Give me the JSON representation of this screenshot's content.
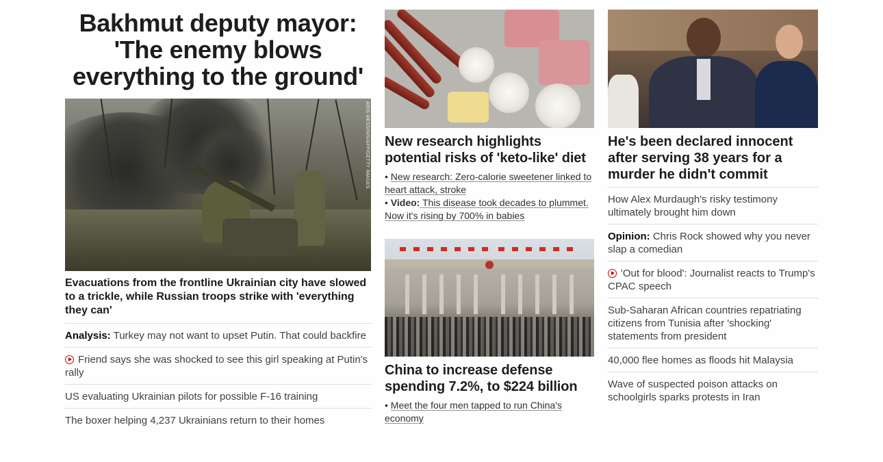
{
  "col1": {
    "headline": "Bakhmut deputy mayor: 'The enemy blows everything to the ground'",
    "image_credit": "ARIS MESSINIS/AFP/GETTY IMAGES",
    "caption": "Evacuations from the frontline Ukrainian city have slowed to a trickle, while Russian troops strike with 'everything they can'",
    "links": [
      {
        "label": "Analysis:",
        "text": " Turkey may not want to upset Putin. That could backfire"
      },
      {
        "text": "Friend says she was shocked to see this girl speaking at Putin's rally",
        "video": true
      },
      {
        "text": "US evaluating Ukrainian pilots for possible F-16 training"
      },
      {
        "text": "The boxer helping 4,237 Ukrainians return to their homes"
      }
    ]
  },
  "col2": {
    "story1": {
      "headline": "New research highlights potential risks of 'keto-like' diet",
      "bullets": [
        {
          "text": "New research: Zero-calorie sweetener linked to heart attack, stroke"
        },
        {
          "label": "Video:",
          "text": " This disease took decades to plummet. Now it's rising by 700% in babies"
        }
      ]
    },
    "story2": {
      "headline": "China to increase defense spending 7.2%, to $224 billion",
      "bullets": [
        {
          "text": "Meet the four men tapped to run China's economy"
        }
      ]
    }
  },
  "col3": {
    "headline": "He's been declared innocent after serving 38 years for a murder he didn't commit",
    "links": [
      {
        "text": "How Alex Murdaugh's risky testimony ultimately brought him down"
      },
      {
        "label": "Opinion:",
        "text": " Chris Rock showed why you never slap a comedian"
      },
      {
        "text": "'Out for blood': Journalist reacts to Trump's CPAC speech",
        "video": true
      },
      {
        "text": "Sub-Saharan African countries repatriating citizens from Tunisia after 'shocking' statements from president"
      },
      {
        "text": "40,000 flee homes as floods hit Malaysia"
      },
      {
        "text": "Wave of suspected poison attacks on schoolgirls sparks protests in Iran"
      }
    ]
  },
  "icons": {
    "video": "play-circle-icon"
  },
  "colors": {
    "video_accent": "#cc0000",
    "divider": "#dcdcdc",
    "text": "#0c0c0c"
  }
}
